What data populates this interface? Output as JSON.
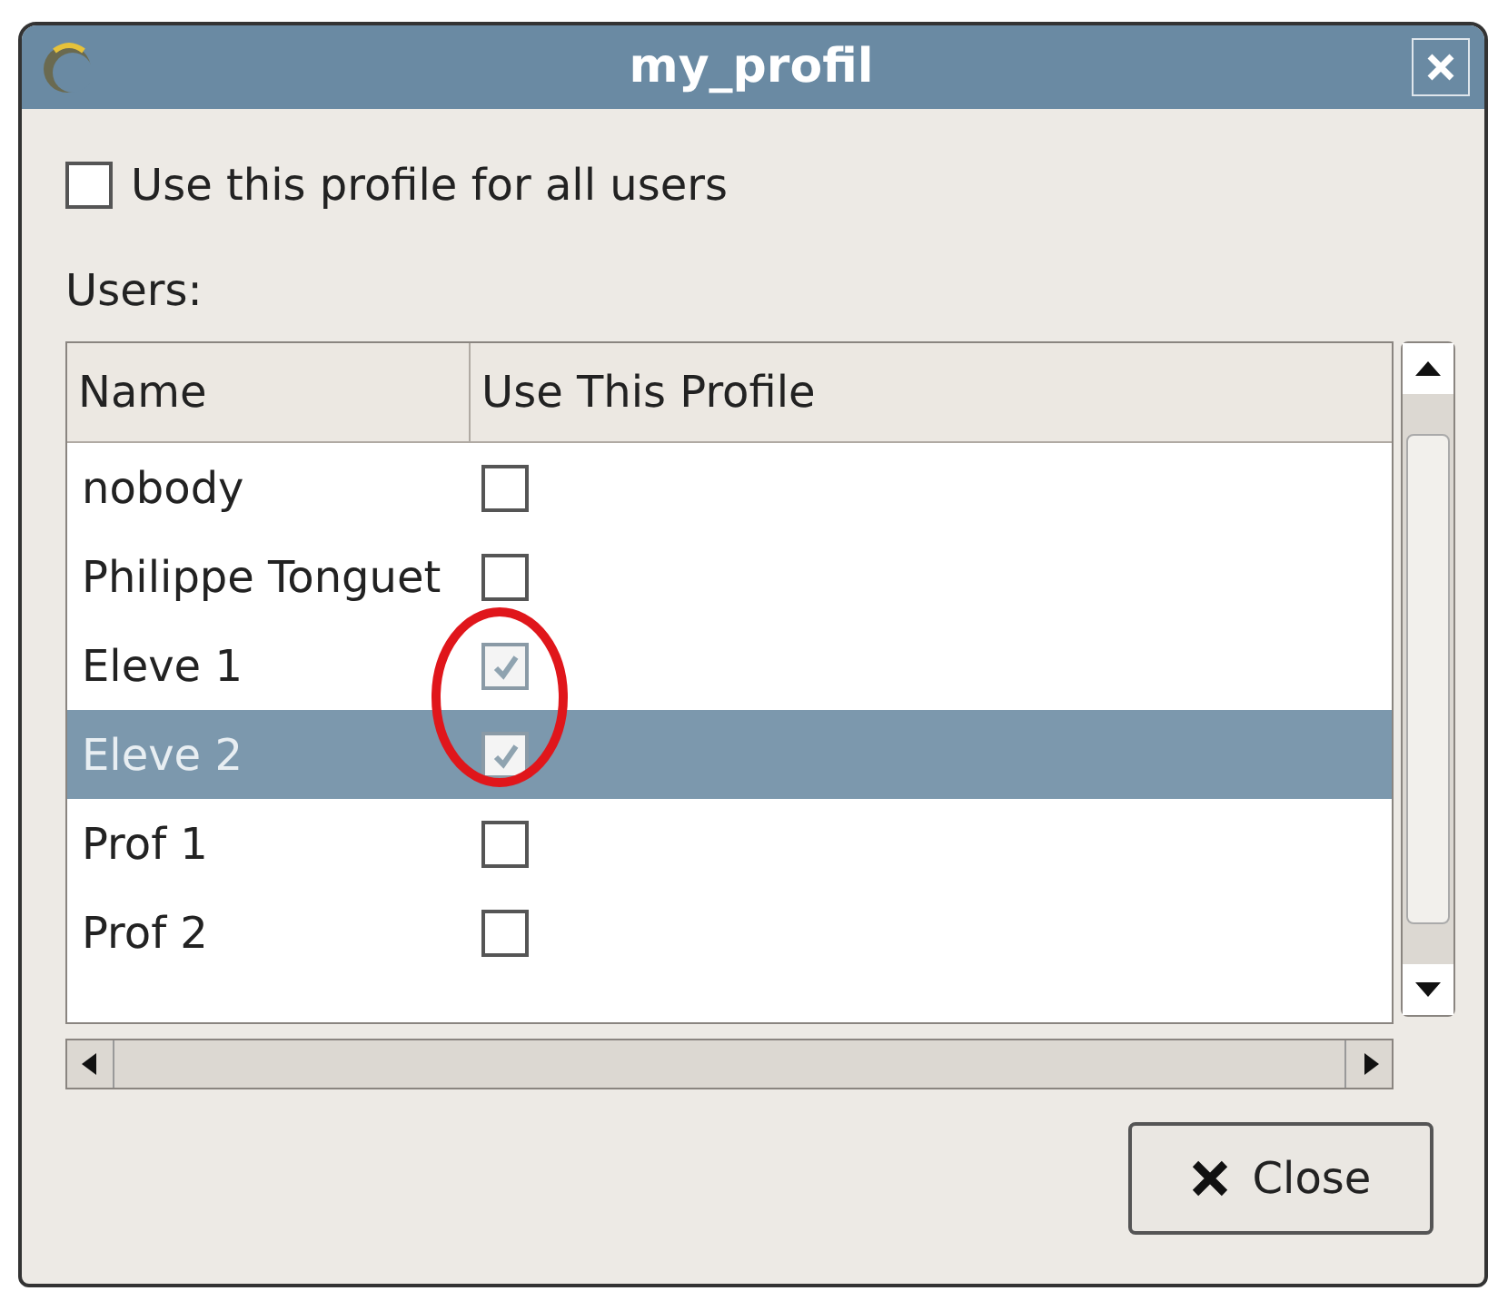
{
  "window": {
    "title": "my_profil"
  },
  "all_users": {
    "label": "Use this profile for all users",
    "checked": false
  },
  "users_label": "Users:",
  "table": {
    "columns": [
      "Name",
      "Use This Profile"
    ],
    "rows": [
      {
        "name": "nobody",
        "checked": false,
        "selected": false
      },
      {
        "name": "Philippe Tonguet",
        "checked": false,
        "selected": false
      },
      {
        "name": "Eleve 1",
        "checked": true,
        "selected": false
      },
      {
        "name": "Eleve 2",
        "checked": true,
        "selected": true
      },
      {
        "name": "Prof 1",
        "checked": false,
        "selected": false
      },
      {
        "name": "Prof 2",
        "checked": false,
        "selected": false
      }
    ]
  },
  "buttons": [
    {
      "label": "Close"
    }
  ]
}
